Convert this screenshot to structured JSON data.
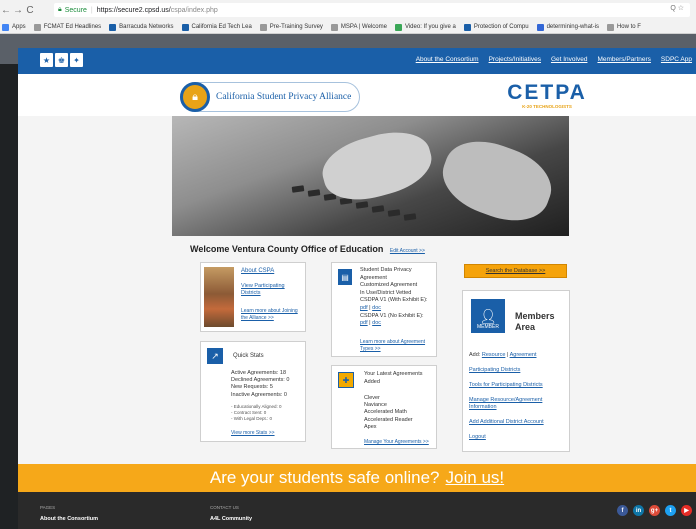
{
  "browser": {
    "secure_label": "Secure",
    "url_prefix": "https://secure2.cpsd.us/",
    "url_rest": "cspa/index.php",
    "omni_icons": "Q ☆",
    "bookmarks": [
      {
        "label": "Apps",
        "color": "#4285f4"
      },
      {
        "label": "FCMAT Ed Headlines",
        "color": "#999999"
      },
      {
        "label": "Barracuda Networks",
        "color": "#1a5fa8"
      },
      {
        "label": "California Ed Tech Lea",
        "color": "#1a5fa8"
      },
      {
        "label": "Pre-Training Survey",
        "color": "#999999"
      },
      {
        "label": "MSPA | Welcome",
        "color": "#999999"
      },
      {
        "label": "Video: If you give a",
        "color": "#3aa757"
      },
      {
        "label": "Protection of Compu",
        "color": "#1a5fa8"
      },
      {
        "label": "determining-what-is",
        "color": "#3367d6"
      },
      {
        "label": "How to F",
        "color": "#999999"
      }
    ]
  },
  "header": {
    "nav": [
      "About the Consortium",
      "Projects/Initiatives",
      "Get Involved",
      "Members/Partners",
      "SDPC App"
    ]
  },
  "logos": {
    "cspa": "California Student Privacy Alliance",
    "cetpa": "CETPA",
    "cetpa_sub": "K-20 TECHNOLOGISTS"
  },
  "welcome": {
    "title": "Welcome Ventura County Office of Education",
    "edit": "Edit Account >>"
  },
  "about_card": {
    "title": "About CSPA",
    "link": "View Participating Districts",
    "more": "Learn more about Joining the Alliance >>"
  },
  "agreement_card": {
    "lines": [
      "Student Data Privacy Agreement",
      "Customized Agreement",
      "In Use/District Vetted",
      "CSDPA V1 (With Exhibit E):"
    ],
    "pdf": "pdf",
    "doc": "doc",
    "sep": " | ",
    "line2": "CSDPA V1 (No Exhibit E):",
    "more": "Learn more about Agreement Types >>"
  },
  "quick_stats": {
    "title": "Quick Stats",
    "stats": [
      "Active Agreements: 18",
      "Declined Agreements: 0",
      "New Requests: 5",
      "Inactive Agreements: 0"
    ],
    "sub": [
      "- Educationally Aligned: 0",
      "- Contract Sent: 0",
      "- With Legal Dept.: 0"
    ],
    "more": "View more Stats >>"
  },
  "latest": {
    "title": "Your Latest Agreements Added",
    "items": [
      "Clever",
      "Naviance",
      "Accelerated Math",
      "Accelerated Reader",
      "Apex"
    ],
    "manage": "Manage Your Agreements >>"
  },
  "search_button": "Search the Database >>",
  "members": {
    "badge": "MEMBER",
    "title": "Members Area",
    "add_prefix": "Add:",
    "add_resource": "Resource",
    "add_sep": " | ",
    "add_agreement": "Agreement",
    "links": [
      "Participating Districts",
      "Tools for Participating Districts",
      "Manage Resource/Agreement Information",
      "Add Additional District Account",
      "Logout"
    ]
  },
  "cta": {
    "text": "Are your students safe online?",
    "link": "Join us!"
  },
  "footer": {
    "pages_head": "PAGES",
    "pages_link": "About the Consortium",
    "contact_head": "CONTACT US",
    "contact_link": "A4L Community",
    "social": [
      {
        "name": "facebook-icon",
        "glyph": "f",
        "color": "#3b5998"
      },
      {
        "name": "linkedin-icon",
        "glyph": "in",
        "color": "#0e76a8"
      },
      {
        "name": "google-plus-icon",
        "glyph": "g+",
        "color": "#dd4b39"
      },
      {
        "name": "twitter-icon",
        "glyph": "t",
        "color": "#1da1f2"
      },
      {
        "name": "youtube-icon",
        "glyph": "▶",
        "color": "#e52d27"
      }
    ]
  }
}
